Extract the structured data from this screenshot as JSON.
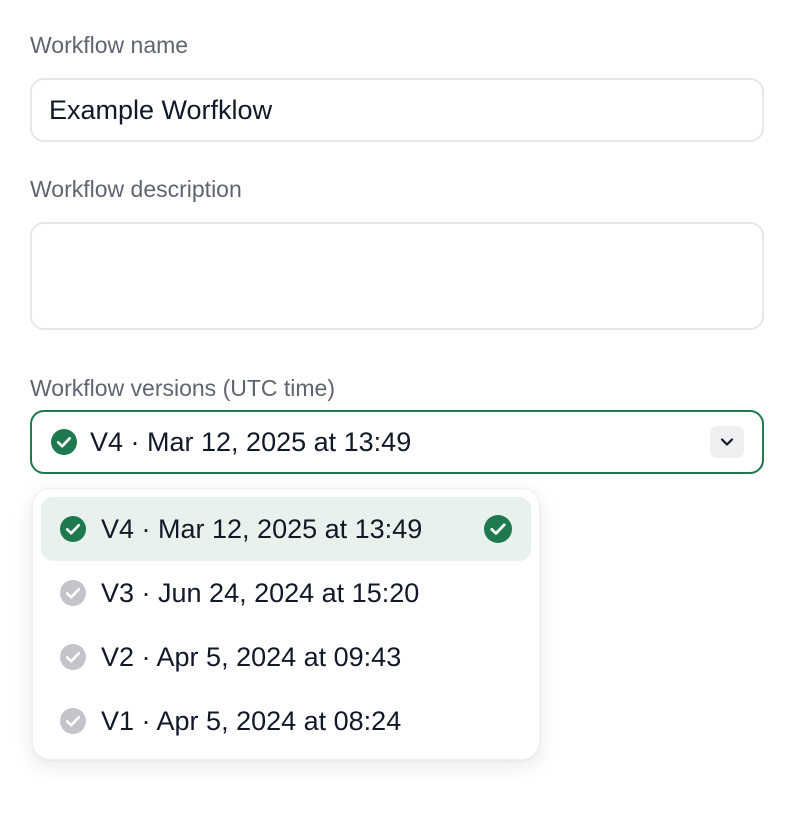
{
  "form": {
    "name_label": "Workflow name",
    "name_value": "Example Worfklow",
    "description_label": "Workflow description",
    "description_value": "",
    "versions_label": "Workflow versions (UTC time)"
  },
  "versions_select": {
    "selected_label": "V4 · Mar 12, 2025 at 13:49",
    "expanded": true
  },
  "versions_menu": {
    "items": [
      {
        "label": "V4 · Mar 12, 2025 at 13:49",
        "selected": true,
        "status": "active"
      },
      {
        "label": "V3 · Jun 24, 2024 at 15:20",
        "selected": false,
        "status": "inactive"
      },
      {
        "label": "V2 · Apr 5, 2024 at 09:43",
        "selected": false,
        "status": "inactive"
      },
      {
        "label": "V1 · Apr 5, 2024 at 08:24",
        "selected": false,
        "status": "inactive"
      }
    ]
  },
  "icons": {
    "status_active": "check-circle-icon",
    "status_inactive": "check-circle-icon",
    "selected_marker": "check-circle-icon",
    "dropdown": "chevron-down-icon"
  },
  "colors": {
    "accent": "#1e7a4e",
    "inactive_icon": "#c2c4ca",
    "selected_row_bg": "#e8f1ec",
    "label_text": "#5f6570",
    "border": "#e5e7eb"
  }
}
